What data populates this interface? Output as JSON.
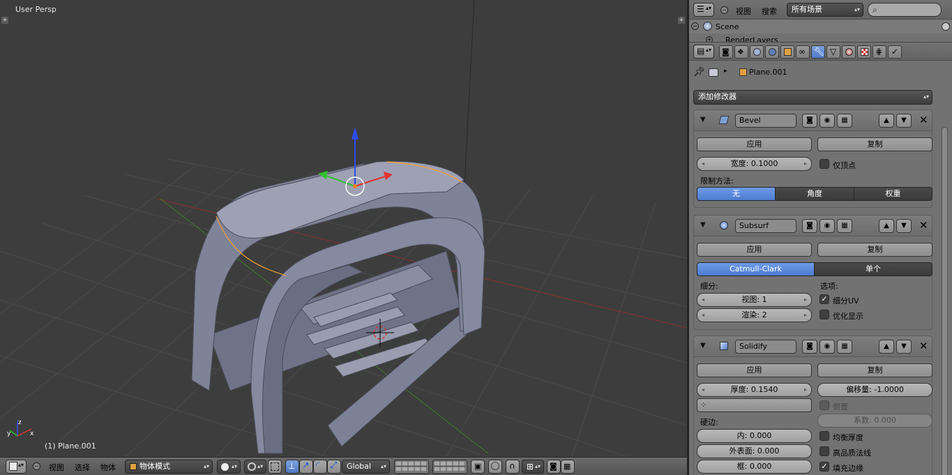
{
  "viewport": {
    "view_label": "User Persp",
    "object_label": "(1) Plane.001",
    "axis_x": "x",
    "axis_y": "y",
    "axis_z": "z"
  },
  "viewport_header": {
    "menu_view": "视图",
    "menu_select": "选择",
    "menu_object": "物体",
    "mode": "物体模式",
    "orientation": "Global"
  },
  "outliner": {
    "menu_view": "视图",
    "menu_search": "搜索",
    "scene_filter": "所有场景",
    "tree_scene": "Scene",
    "tree_renderlayers": "RenderLayers"
  },
  "properties": {
    "breadcrumb_object": "Plane.001",
    "add_modifier": "添加修改器",
    "bevel": {
      "name": "Bevel",
      "apply": "应用",
      "copy": "复制",
      "width": "宽度: 0.1000",
      "only_vertices": "仅顶点",
      "limit_method_label": "限制方法:",
      "limit_none": "无",
      "limit_angle": "角度",
      "limit_weight": "权重"
    },
    "subsurf": {
      "name": "Subsurf",
      "apply": "应用",
      "copy": "复制",
      "alg_catmull": "Catmull-Clark",
      "alg_simple": "单个",
      "subdiv_label": "细分:",
      "view": "视图: 1",
      "render": "渲染: 2",
      "options_label": "选项:",
      "subdivide_uvs": "细分UV",
      "optimal_display": "优化显示"
    },
    "solidify": {
      "name": "Solidify",
      "apply": "应用",
      "copy": "复制",
      "thickness": "厚度: 0.1540",
      "offset": "偏移量: -1.0000",
      "flip": "倒置",
      "factor": "系数: 0.000",
      "crease_label": "硬边:",
      "inner": "内: 0.000",
      "outer": "外表面: 0.000",
      "rim": "框: 0.000",
      "even_thickness": "均衡厚度",
      "high_quality_normals": "高品质法线",
      "fill_rim": "填充边缘"
    }
  },
  "colors": {
    "active_blue": "#5680d8",
    "selection_orange": "#f0a030"
  }
}
